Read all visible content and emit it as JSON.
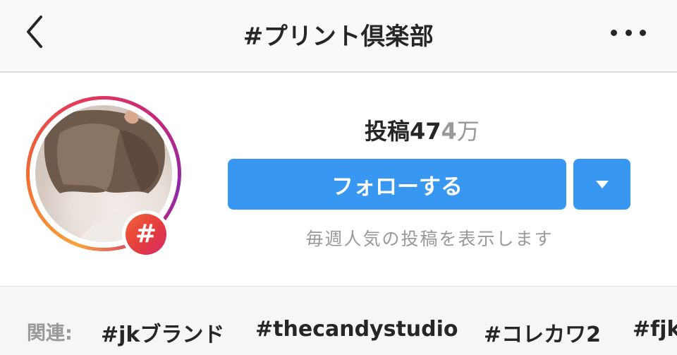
{
  "header": {
    "back_icon": "chevron-left-icon",
    "title": "#プリント倶楽部",
    "more_icon": "more-horizontal-icon"
  },
  "profile": {
    "avatar_badge": "#",
    "posts_label": "投稿",
    "posts_count_main": "47",
    "posts_count_faded": "4",
    "posts_unit": "万",
    "follow_button": "フォローする",
    "dropdown_icon": "caret-down-icon",
    "weekly_text": "毎週人気の投稿を表示します"
  },
  "related": {
    "label": "関連:",
    "tags": [
      "#jkブランド",
      "#thecandystudio",
      "#コレカワ2",
      "#fjk"
    ]
  },
  "colors": {
    "accent": "#3897f0",
    "text": "#262626",
    "muted": "#999999"
  }
}
